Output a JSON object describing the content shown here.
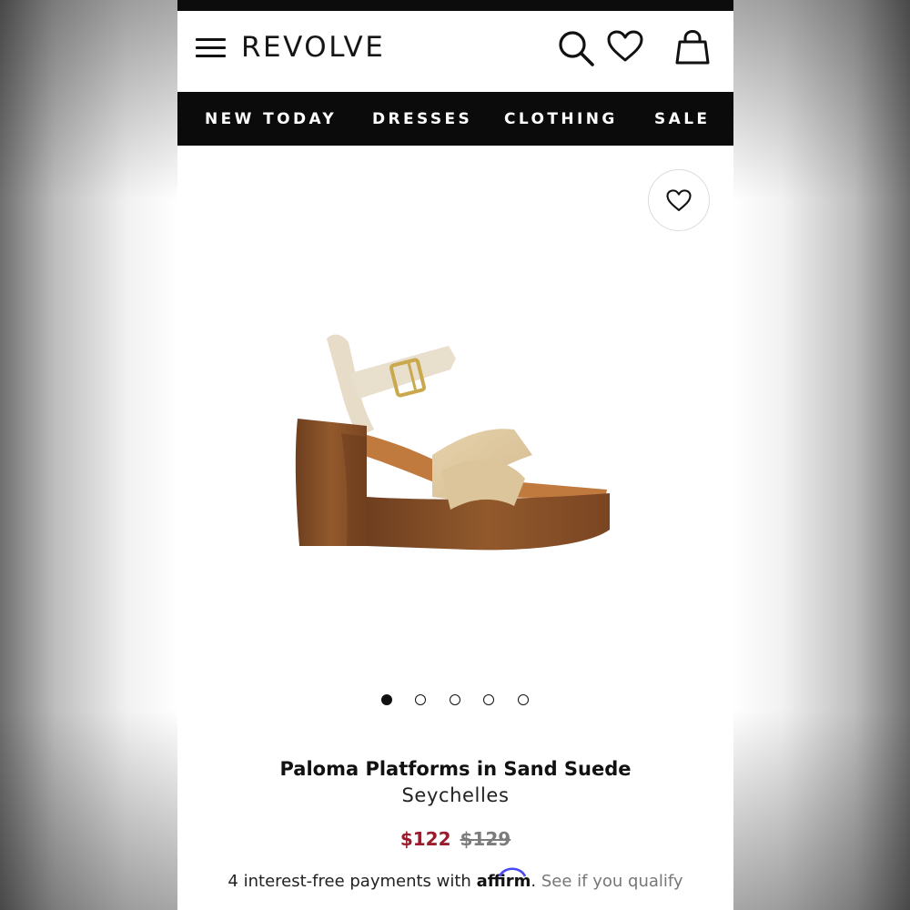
{
  "header": {
    "brand": "REVOLVE",
    "icons": [
      "menu-icon",
      "search-icon",
      "heart-icon",
      "bag-icon"
    ]
  },
  "nav": {
    "items": [
      {
        "label": "NEW TODAY"
      },
      {
        "label": "DRESSES"
      },
      {
        "label": "CLOTHING"
      },
      {
        "label": "SALE"
      }
    ]
  },
  "gallery": {
    "image_count": 5,
    "active_index": 0
  },
  "product": {
    "title": "Paloma Platforms in Sand Suede",
    "brand": "Seychelles",
    "price_sale": "$122",
    "price_original": "$129"
  },
  "affirm": {
    "prefix": "4 interest-free payments with ",
    "logo": "affirm",
    "separator": ".",
    "link": " See if you qualify"
  },
  "colors": {
    "sale_price": "#9a1b2c",
    "nav_background": "#0b0b0b",
    "affirm_blue": "#4a4af4"
  }
}
